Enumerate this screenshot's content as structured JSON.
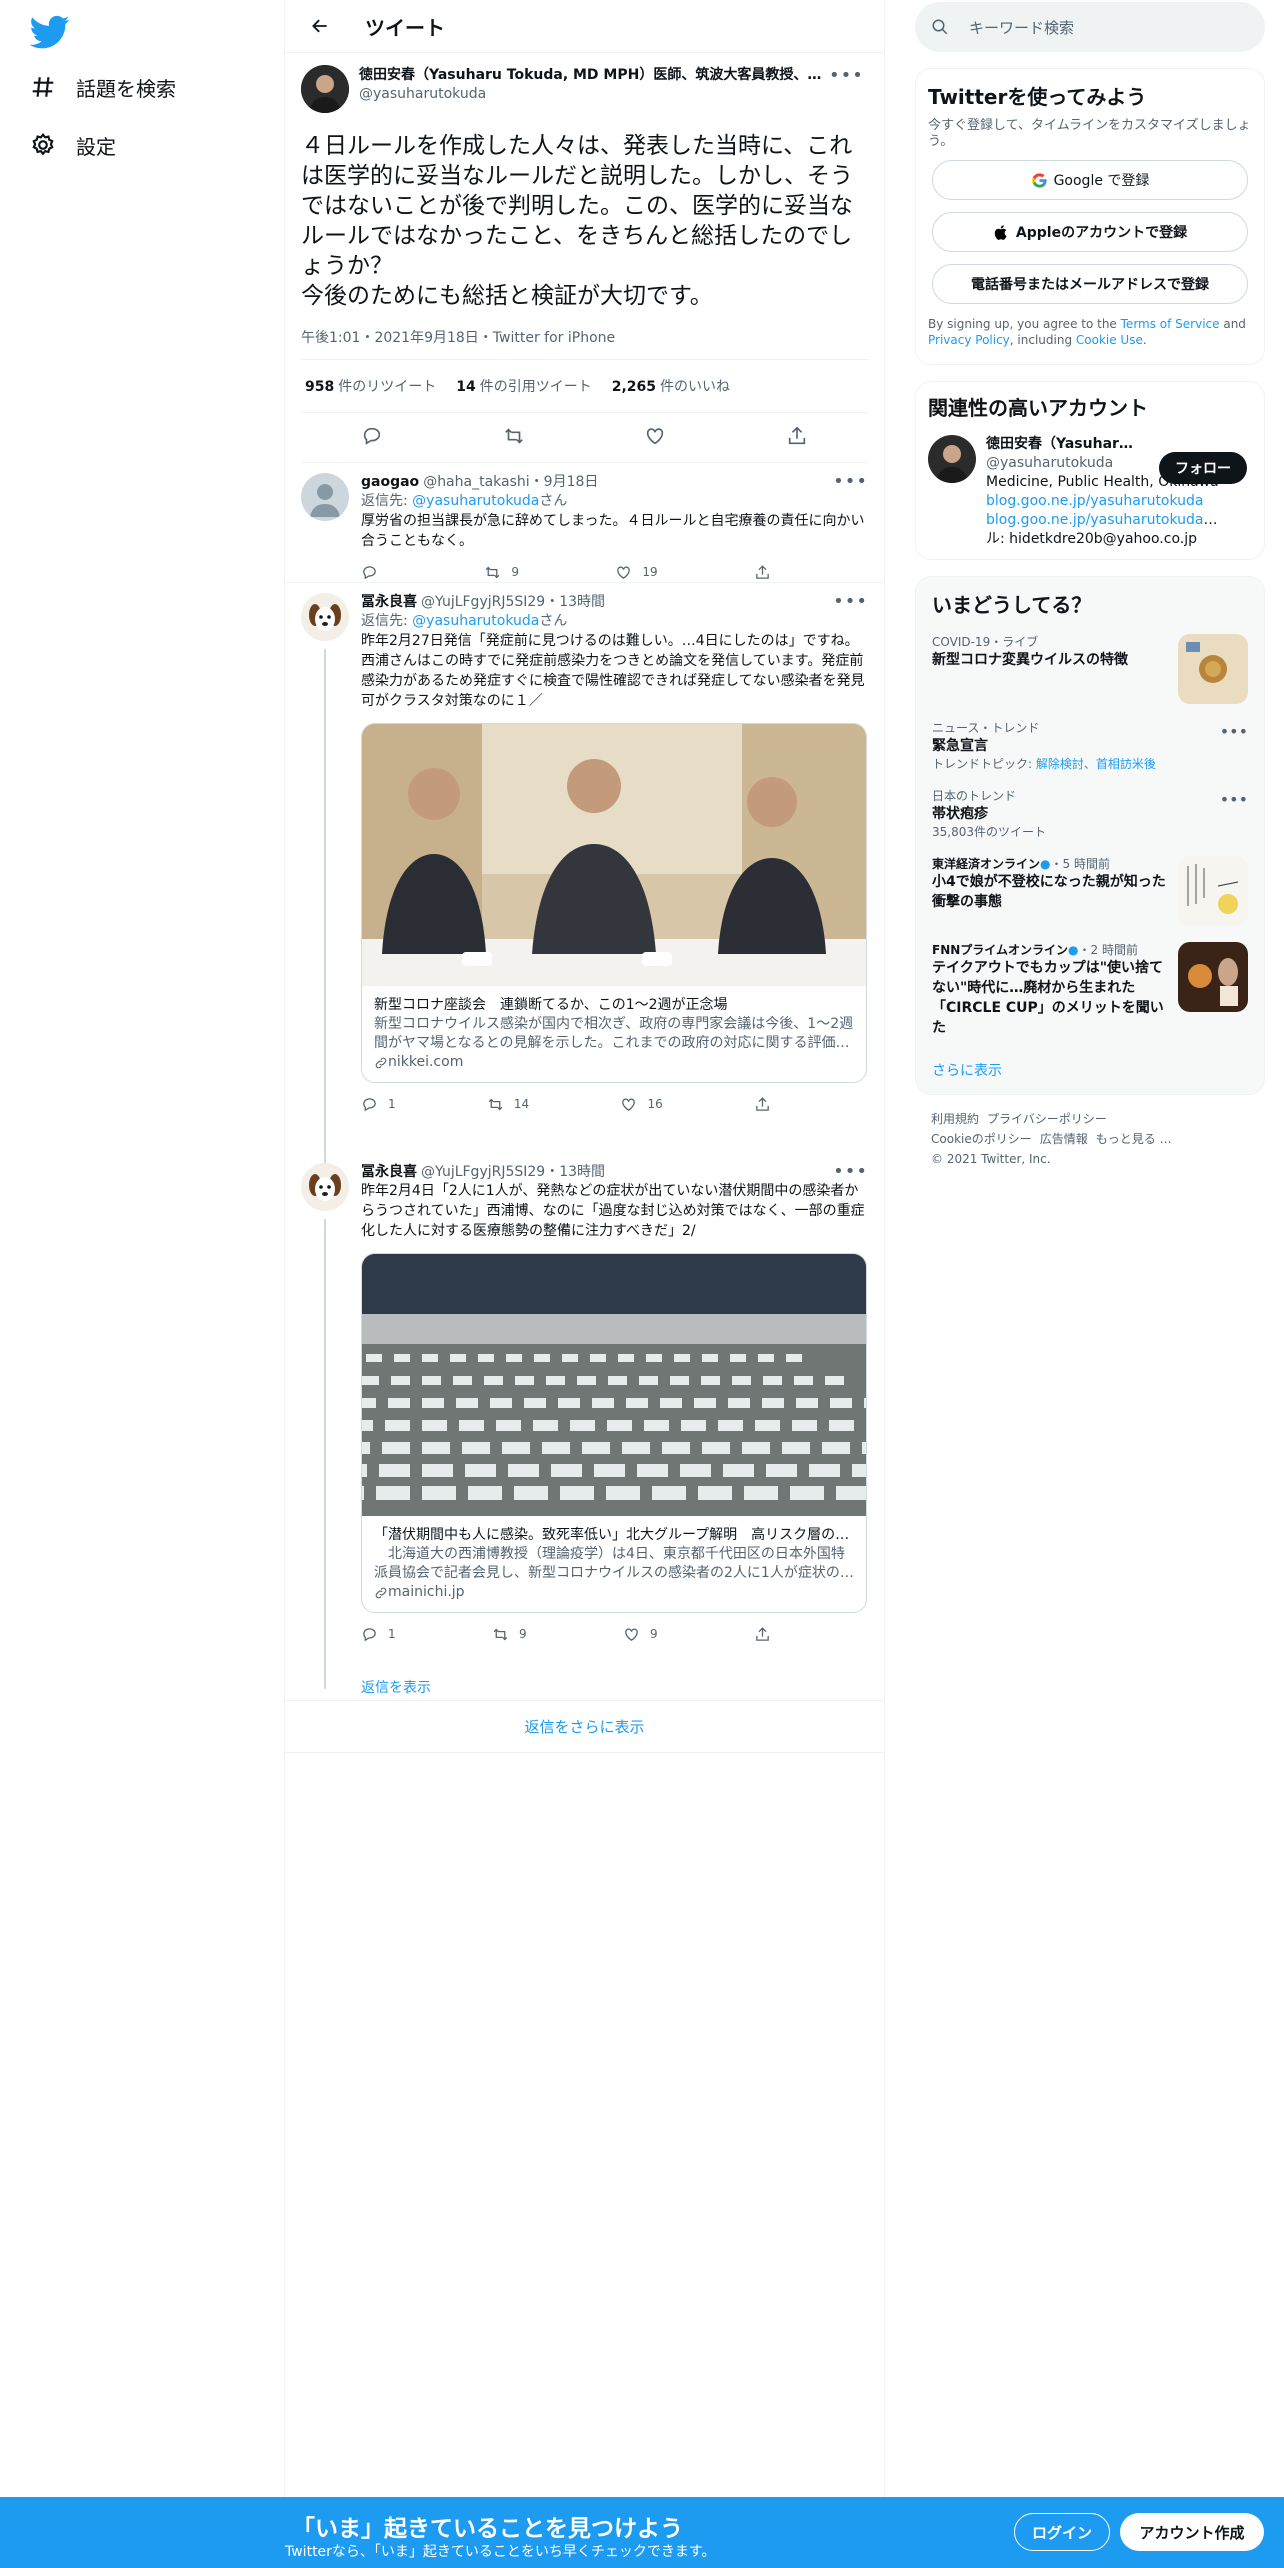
{
  "nav": {
    "explore_label": "話題を検索",
    "settings_label": "設定"
  },
  "header": {
    "title": "ツイート"
  },
  "focal": {
    "name": "徳田安春（Yasuharu Tokuda, MD MPH）医師、筑波大客員教授、ハーバード大学",
    "handle": "@yasuharutokuda",
    "text": "４日ルールを作成した人々は、発表した当時に、これは医学的に妥当なルールだと説明した。しかし、そうではないことが後で判明した。この、医学的に妥当なルールではなかったこと、をきちんと総括したのでしょうか？\n今後のためにも総括と検証が大切です。",
    "meta": "午後1:01・2021年9月18日・Twitter for iPhone",
    "stats": [
      {
        "n": "958",
        "label": "件のリツイート"
      },
      {
        "n": "14",
        "label": "件の引用ツイート"
      },
      {
        "n": "2,265",
        "label": "件のいいね"
      }
    ]
  },
  "replies": [
    {
      "name": "gaogao",
      "rest": "@haha_takashi・9月18日",
      "to_prefix": "返信先: ",
      "to_handle": "@yasuharutokuda",
      "to_suffix": "さん",
      "text": "厚労省の担当課長が急に辞めてしまった。４日ルールと自宅療養の責任に向かい合うこともなく。",
      "reply_count": "",
      "retweet_count": "9",
      "like_count": "19"
    },
    {
      "name": "冨永良喜",
      "rest": "@YujLFgyjRJ5SI29・13時間",
      "to_prefix": "返信先: ",
      "to_handle": "@yasuharutokuda",
      "to_suffix": "さん",
      "text": "昨年2月27日発信「発症前に見つけるのは難しい。…4日にしたのは」ですね。西浦さんはこの時すでに発症前感染力をつきとめ論文を発信しています。発症前感染力があるため発症すぐに検査で陽性確認できれば発症してない感染者を発見可がクラスタ対策なのに１／",
      "card_title": "新型コロナ座談会　連鎖断てるか、この1～2週が正念場",
      "card_desc": "新型コロナウイルス感染が国内で相次ぎ、政府の専門家会議は今後、1～2週間がヤマ場となるとの見解を示した。これまでの政府の対応に関する評価を含め、専門家に話を聞いた。",
      "card_domain": "nikkei.com",
      "reply_count": "1",
      "retweet_count": "14",
      "like_count": "16"
    },
    {
      "name": "冨永良喜",
      "rest": "@YujLFgyjRJ5SI29・13時間",
      "text": "昨年2月4日「2人に1人が、発熱などの症状が出ていない潜伏期間中の感染者からうつされていた」西浦博、なのに「過度な封じ込め対策ではなく、一部の重症化した人に対する医療態勢の整備に注力すべきだ」2/",
      "card_title": "「潜伏期間中も人に感染。致死率低い」北大グループ解明　高リスク層の医療に重点を",
      "card_desc": "　北海道大の西浦博教授（理論疫学）は4日、東京都千代田区の日本外国特派員協会で記者会見し、新型コロナウイルスの感染者の2人に1人が症状の出ていない潜伏期間中に感染させていた可能性があると発表した。",
      "card_domain": "mainichi.jp",
      "reply_count": "1",
      "retweet_count": "9",
      "like_count": "9"
    }
  ],
  "show_replies": "返信を表示",
  "show_more_replies": "返信をさらに表示",
  "search": {
    "placeholder": "キーワード検索"
  },
  "signup": {
    "title": "Twitterを使ってみよう",
    "sub": "今すぐ登録して、タイムラインをカスタマイズしましょう。",
    "google": "Google で登録",
    "apple": "Appleのアカウントで登録",
    "phone": "電話番号またはメールアドレスで登録",
    "terms_pre": "By signing up, you agree to the ",
    "terms_link": "Terms of Service",
    "terms_and": " and ",
    "privacy_link": "Privacy Policy",
    "including": ", including ",
    "cookie_link": "Cookie Use",
    "period": "."
  },
  "related": {
    "title": "関連性の高いアカウント",
    "name": "徳田安春（Yasuharu Tokuda, MD MPH）",
    "handle": "@yasuharutokuda",
    "follow": "フォロー",
    "bio1": "Medicine, Public Health, Okinawa",
    "link1": "blog.goo.ne.jp/yasuharutokuda",
    "link2": "blog.goo.ne.jp/yasuharutokuda…",
    "bio_mail_a": " メー",
    "bio_mail_b": "ル: hidetkdre20b@yahoo.co.jp"
  },
  "trends": {
    "title": "いまどうしてる？",
    "items": [
      {
        "ctx": "COVID-19・ライブ",
        "title": "新型コロナ変異ウイルスの特徴"
      },
      {
        "ctx": "ニュース・トレンド",
        "title": "緊急宣言",
        "topic_prefix": "トレンドトピック: ",
        "topic_links": "解除検討、首相訪米後"
      },
      {
        "ctx": "日本のトレンド",
        "title": "帯状疱疹",
        "small": "35,803件のツイート"
      },
      {
        "ctx_src": "東洋経済オンライン",
        "ctx_time": "・5 時間前",
        "title": "小4で娘が不登校になった親が知った衝撃の事態"
      },
      {
        "ctx_src": "FNNプライムオンライン",
        "ctx_time": "・2 時間前",
        "title": "テイクアウトでもカップは\"使い捨てない\"時代に…廃材から生まれた「CIRCLE CUP」のメリットを聞いた"
      }
    ],
    "show_more": "さらに表示"
  },
  "footer": {
    "links": [
      "利用規約",
      "プライバシーポリシー",
      "Cookieのポリシー",
      "広告情報",
      "もっと見る …"
    ],
    "copyright": "© 2021 Twitter, Inc."
  },
  "bottombar": {
    "title": "「いま」起きていることを見つけよう",
    "sub": "Twitterなら、「いま」起きていることをいち早くチェックできます。",
    "login": "ログイン",
    "signup": "アカウント作成"
  },
  "colors": {
    "accent": "#1d9bf0",
    "text": "#0f1419",
    "muted": "#536471"
  }
}
